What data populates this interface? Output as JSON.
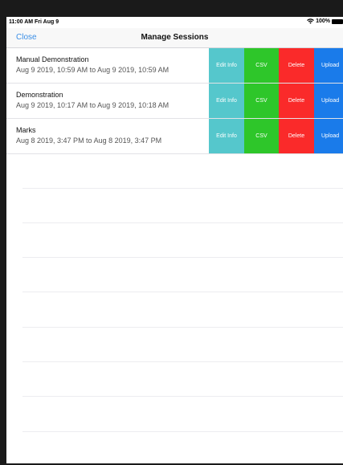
{
  "status_bar": {
    "time_date": "11:00 AM  Fri Aug 9",
    "battery": "100%",
    "icons": [
      "wifi-icon",
      "battery-icon"
    ]
  },
  "nav": {
    "close_label": "Close",
    "title": "Manage Sessions"
  },
  "actions": {
    "edit_info": "Edit Info",
    "csv": "CSV",
    "delete": "Delete",
    "upload": "Upload"
  },
  "colors": {
    "edit_info": "#55c7cc",
    "csv": "#2ec62a",
    "delete": "#fa2a2a",
    "upload": "#1a7bea",
    "accent": "#3a8ee6"
  },
  "sessions": [
    {
      "title": "Manual Demonstration",
      "range": "Aug 9 2019, 10:59 AM to Aug 9 2019, 10:59 AM"
    },
    {
      "title": "Demonstration",
      "range": "Aug 9 2019, 10:17 AM to Aug 9 2019, 10:18 AM"
    },
    {
      "title": "Marks",
      "range": "Aug 8 2019, 3:47 PM to Aug 8 2019, 3:47 PM"
    }
  ]
}
